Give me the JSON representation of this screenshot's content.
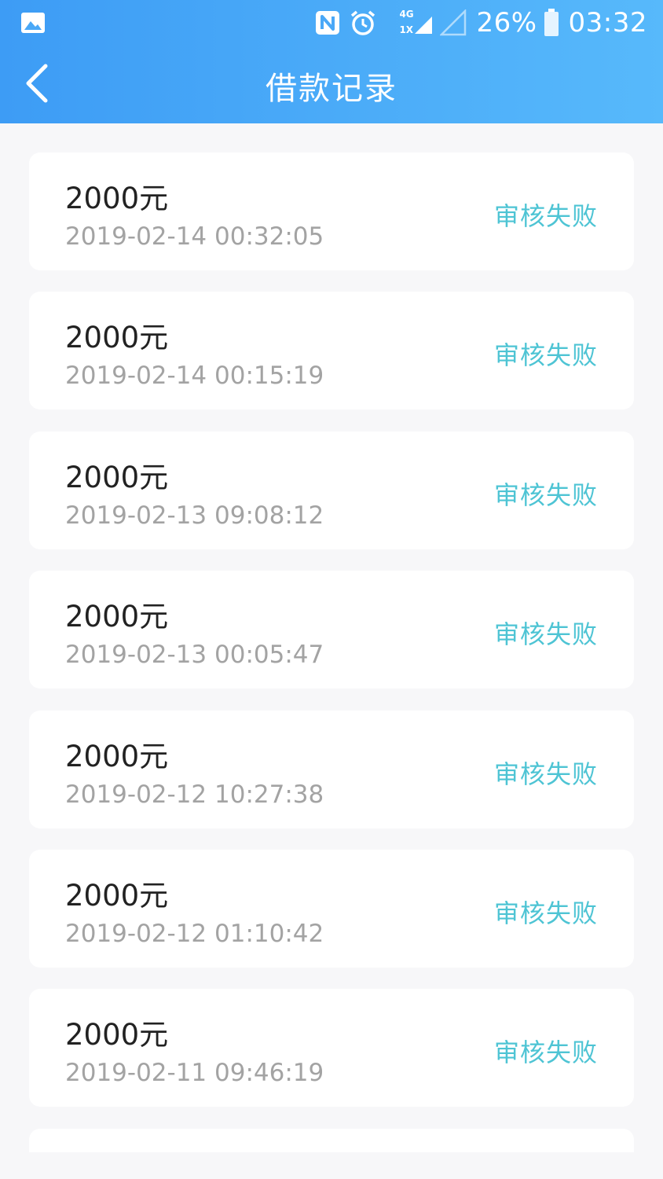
{
  "status_bar": {
    "battery": "26%",
    "time": "03:32",
    "network_top": "4G",
    "network_bottom": "1X",
    "icons": [
      "gallery-icon",
      "nfc-icon",
      "alarm-icon",
      "signal-icon",
      "signal-empty-icon",
      "battery-icon"
    ]
  },
  "header": {
    "title": "借款记录",
    "back_icon": "chevron-left-icon"
  },
  "colors": {
    "header_start": "#3d9cf5",
    "header_end": "#57b9fb",
    "status_text": "#4ec4d4",
    "background": "#f7f7f9"
  },
  "records": [
    {
      "amount": "2000元",
      "datetime": "2019-02-14 00:32:05",
      "status": "审核失败"
    },
    {
      "amount": "2000元",
      "datetime": "2019-02-14 00:15:19",
      "status": "审核失败"
    },
    {
      "amount": "2000元",
      "datetime": "2019-02-13 09:08:12",
      "status": "审核失败"
    },
    {
      "amount": "2000元",
      "datetime": "2019-02-13 00:05:47",
      "status": "审核失败"
    },
    {
      "amount": "2000元",
      "datetime": "2019-02-12 10:27:38",
      "status": "审核失败"
    },
    {
      "amount": "2000元",
      "datetime": "2019-02-12 01:10:42",
      "status": "审核失败"
    },
    {
      "amount": "2000元",
      "datetime": "2019-02-11 09:46:19",
      "status": "审核失败"
    }
  ]
}
